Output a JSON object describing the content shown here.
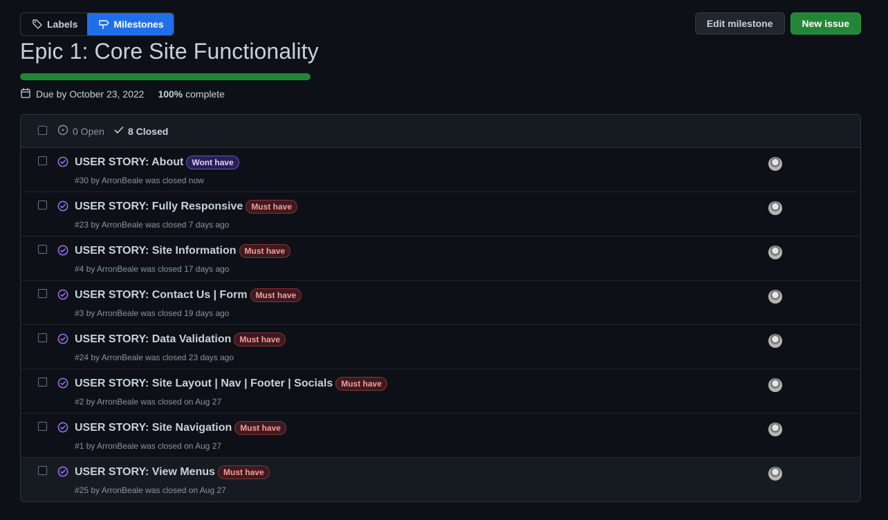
{
  "nav": {
    "labels_tab": "Labels",
    "milestones_tab": "Milestones"
  },
  "actions": {
    "edit_milestone": "Edit milestone",
    "new_issue": "New issue"
  },
  "milestone": {
    "title": "Epic 1: Core Site Functionality",
    "progress_fraction": 1.0,
    "due_text": "Due by October 23, 2022",
    "percent": "100%",
    "complete_suffix": " complete"
  },
  "filters": {
    "open": "0 Open",
    "closed": "8 Closed"
  },
  "colors": {
    "accent_blue": "#1f6feb",
    "success_green": "#238636",
    "closed_purple": "#a371f7"
  },
  "issues": [
    {
      "title": "USER STORY: About",
      "label": "Wont have",
      "label_kind": "wont",
      "meta": "#30 by ArronBeale was closed now"
    },
    {
      "title": "USER STORY: Fully Responsive",
      "label": "Must have",
      "label_kind": "must",
      "meta": "#23 by ArronBeale was closed 7 days ago"
    },
    {
      "title": "USER STORY: Site Information",
      "label": "Must have",
      "label_kind": "must",
      "meta": "#4 by ArronBeale was closed 17 days ago"
    },
    {
      "title": "USER STORY: Contact Us | Form",
      "label": "Must have",
      "label_kind": "must",
      "meta": "#3 by ArronBeale was closed 19 days ago"
    },
    {
      "title": "USER STORY: Data Validation",
      "label": "Must have",
      "label_kind": "must",
      "meta": "#24 by ArronBeale was closed 23 days ago"
    },
    {
      "title": "USER STORY: Site Layout | Nav | Footer | Socials",
      "label": "Must have",
      "label_kind": "must",
      "meta": "#2 by ArronBeale was closed on Aug 27"
    },
    {
      "title": "USER STORY: Site Navigation",
      "label": "Must have",
      "label_kind": "must",
      "meta": "#1 by ArronBeale was closed on Aug 27"
    },
    {
      "title": "USER STORY: View Menus",
      "label": "Must have",
      "label_kind": "must",
      "meta": "#25 by ArronBeale was closed on Aug 27"
    }
  ]
}
